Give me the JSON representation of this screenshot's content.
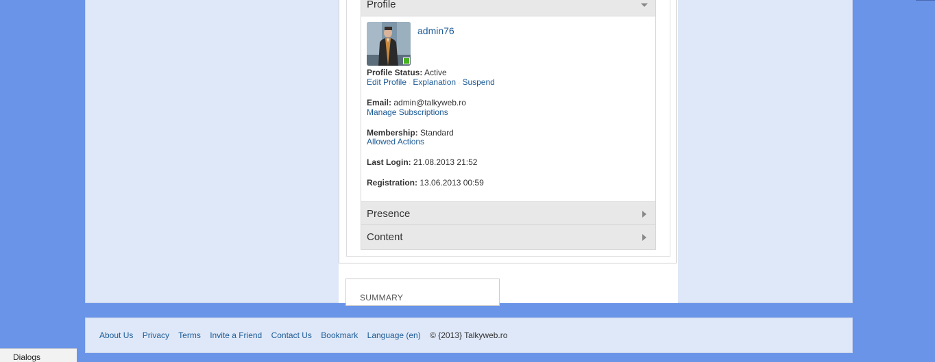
{
  "profile": {
    "section_title": "Profile",
    "username": "admin76",
    "status_label": "Profile Status:",
    "status_value": "Active",
    "actions": [
      "Edit Profile",
      "Explanation",
      "Suspend"
    ],
    "email_label": "Email:",
    "email_value": "admin@talkyweb.ro",
    "manage_subscriptions": "Manage Subscriptions",
    "membership_label": "Membership:",
    "membership_value": "Standard",
    "allowed_actions": "Allowed Actions",
    "last_login_label": "Last Login:",
    "last_login_value": "21.08.2013 21:52",
    "registration_label": "Registration:",
    "registration_value": "13.06.2013 00:59"
  },
  "sections": [
    "Presence",
    "Content"
  ],
  "summary": {
    "title": "SUMMARY"
  },
  "footer": {
    "links": [
      "About Us",
      "Privacy",
      "Terms",
      "Invite a Friend",
      "Contact Us",
      "Bookmark",
      "Language (en)"
    ],
    "copyright": "© {2013} Talkyweb.ro"
  },
  "dialogs": {
    "label": "Dialogs"
  },
  "colors": {
    "background": "#6a94e8",
    "panel": "#dfe8f8",
    "link": "#1d5b96",
    "online": "#45b21e"
  }
}
